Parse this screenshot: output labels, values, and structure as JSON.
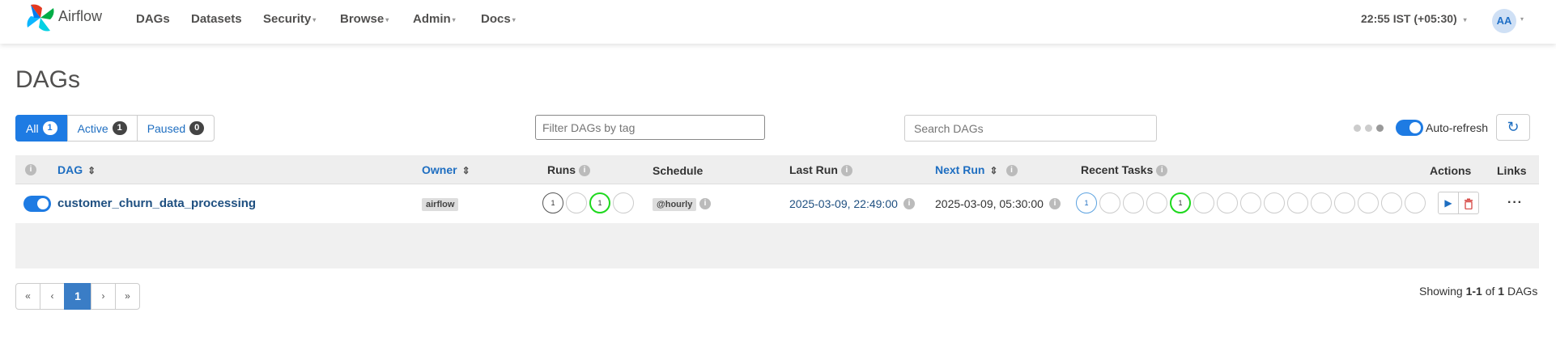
{
  "navbar": {
    "brand": "Airflow",
    "items": [
      {
        "label": "DAGs",
        "dropdown": false
      },
      {
        "label": "Datasets",
        "dropdown": false
      },
      {
        "label": "Security",
        "dropdown": true
      },
      {
        "label": "Browse",
        "dropdown": true
      },
      {
        "label": "Admin",
        "dropdown": true
      },
      {
        "label": "Docs",
        "dropdown": true
      }
    ],
    "clock": "22:55 IST (+05:30)",
    "avatar_initials": "AA"
  },
  "page_title": "DAGs",
  "filters": {
    "tabs": [
      {
        "label": "All",
        "count": "1",
        "active": true
      },
      {
        "label": "Active",
        "count": "1",
        "active": false
      },
      {
        "label": "Paused",
        "count": "0",
        "active": false
      }
    ],
    "tag_placeholder": "Filter DAGs by tag",
    "search_placeholder": "Search DAGs",
    "auto_refresh_label": "Auto-refresh",
    "auto_refresh_on": true
  },
  "table": {
    "headers": {
      "dag": "DAG",
      "owner": "Owner",
      "runs": "Runs",
      "schedule": "Schedule",
      "last_run": "Last Run",
      "next_run": "Next Run",
      "recent_tasks": "Recent Tasks",
      "actions": "Actions",
      "links": "Links"
    },
    "rows": [
      {
        "dag_id": "customer_churn_data_processing",
        "paused": false,
        "owner": "airflow",
        "runs": [
          {
            "count": "1",
            "state": "queued"
          },
          {
            "count": "",
            "state": "running"
          },
          {
            "count": "1",
            "state": "success"
          },
          {
            "count": "",
            "state": "failed"
          }
        ],
        "schedule": "@hourly",
        "last_run": "2025-03-09, 22:49:00",
        "next_run": "2025-03-09, 05:30:00",
        "recent_task_counts": [
          "1",
          "",
          "",
          "",
          "1",
          "",
          "",
          "",
          "",
          "",
          "",
          "",
          "",
          "",
          ""
        ]
      }
    ]
  },
  "pagination": {
    "first": "«",
    "prev": "‹",
    "current": "1",
    "next": "›",
    "last": "»",
    "showing_prefix": "Showing ",
    "showing_range": "1-1",
    "showing_of": " of ",
    "showing_total": "1",
    "showing_suffix": " DAGs"
  },
  "colors": {
    "primary": "#1e7be3",
    "link": "#1e6ec1",
    "success": "#1ed81e",
    "delete": "#d9534f"
  }
}
